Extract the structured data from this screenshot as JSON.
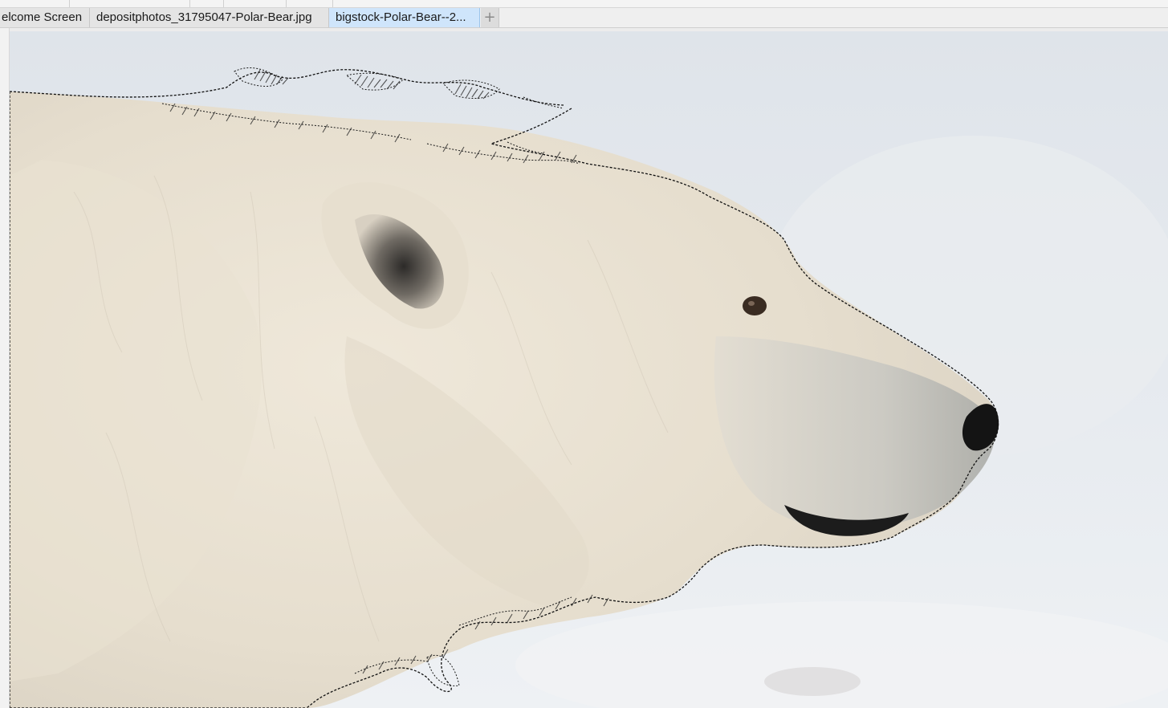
{
  "tabs": [
    {
      "label": "elcome Screen",
      "active": false
    },
    {
      "label": "depositphotos_31795047-Polar-Bear.jpg",
      "active": false
    },
    {
      "label": "bigstock-Polar-Bear--2...",
      "active": true
    }
  ],
  "new_tab_icon": "plus-icon",
  "colors": {
    "active_tab": "#cfe5fb",
    "background_snow": "#e3e7ec",
    "fur": "#ebe4d6",
    "selection_marquee": "#111111"
  }
}
